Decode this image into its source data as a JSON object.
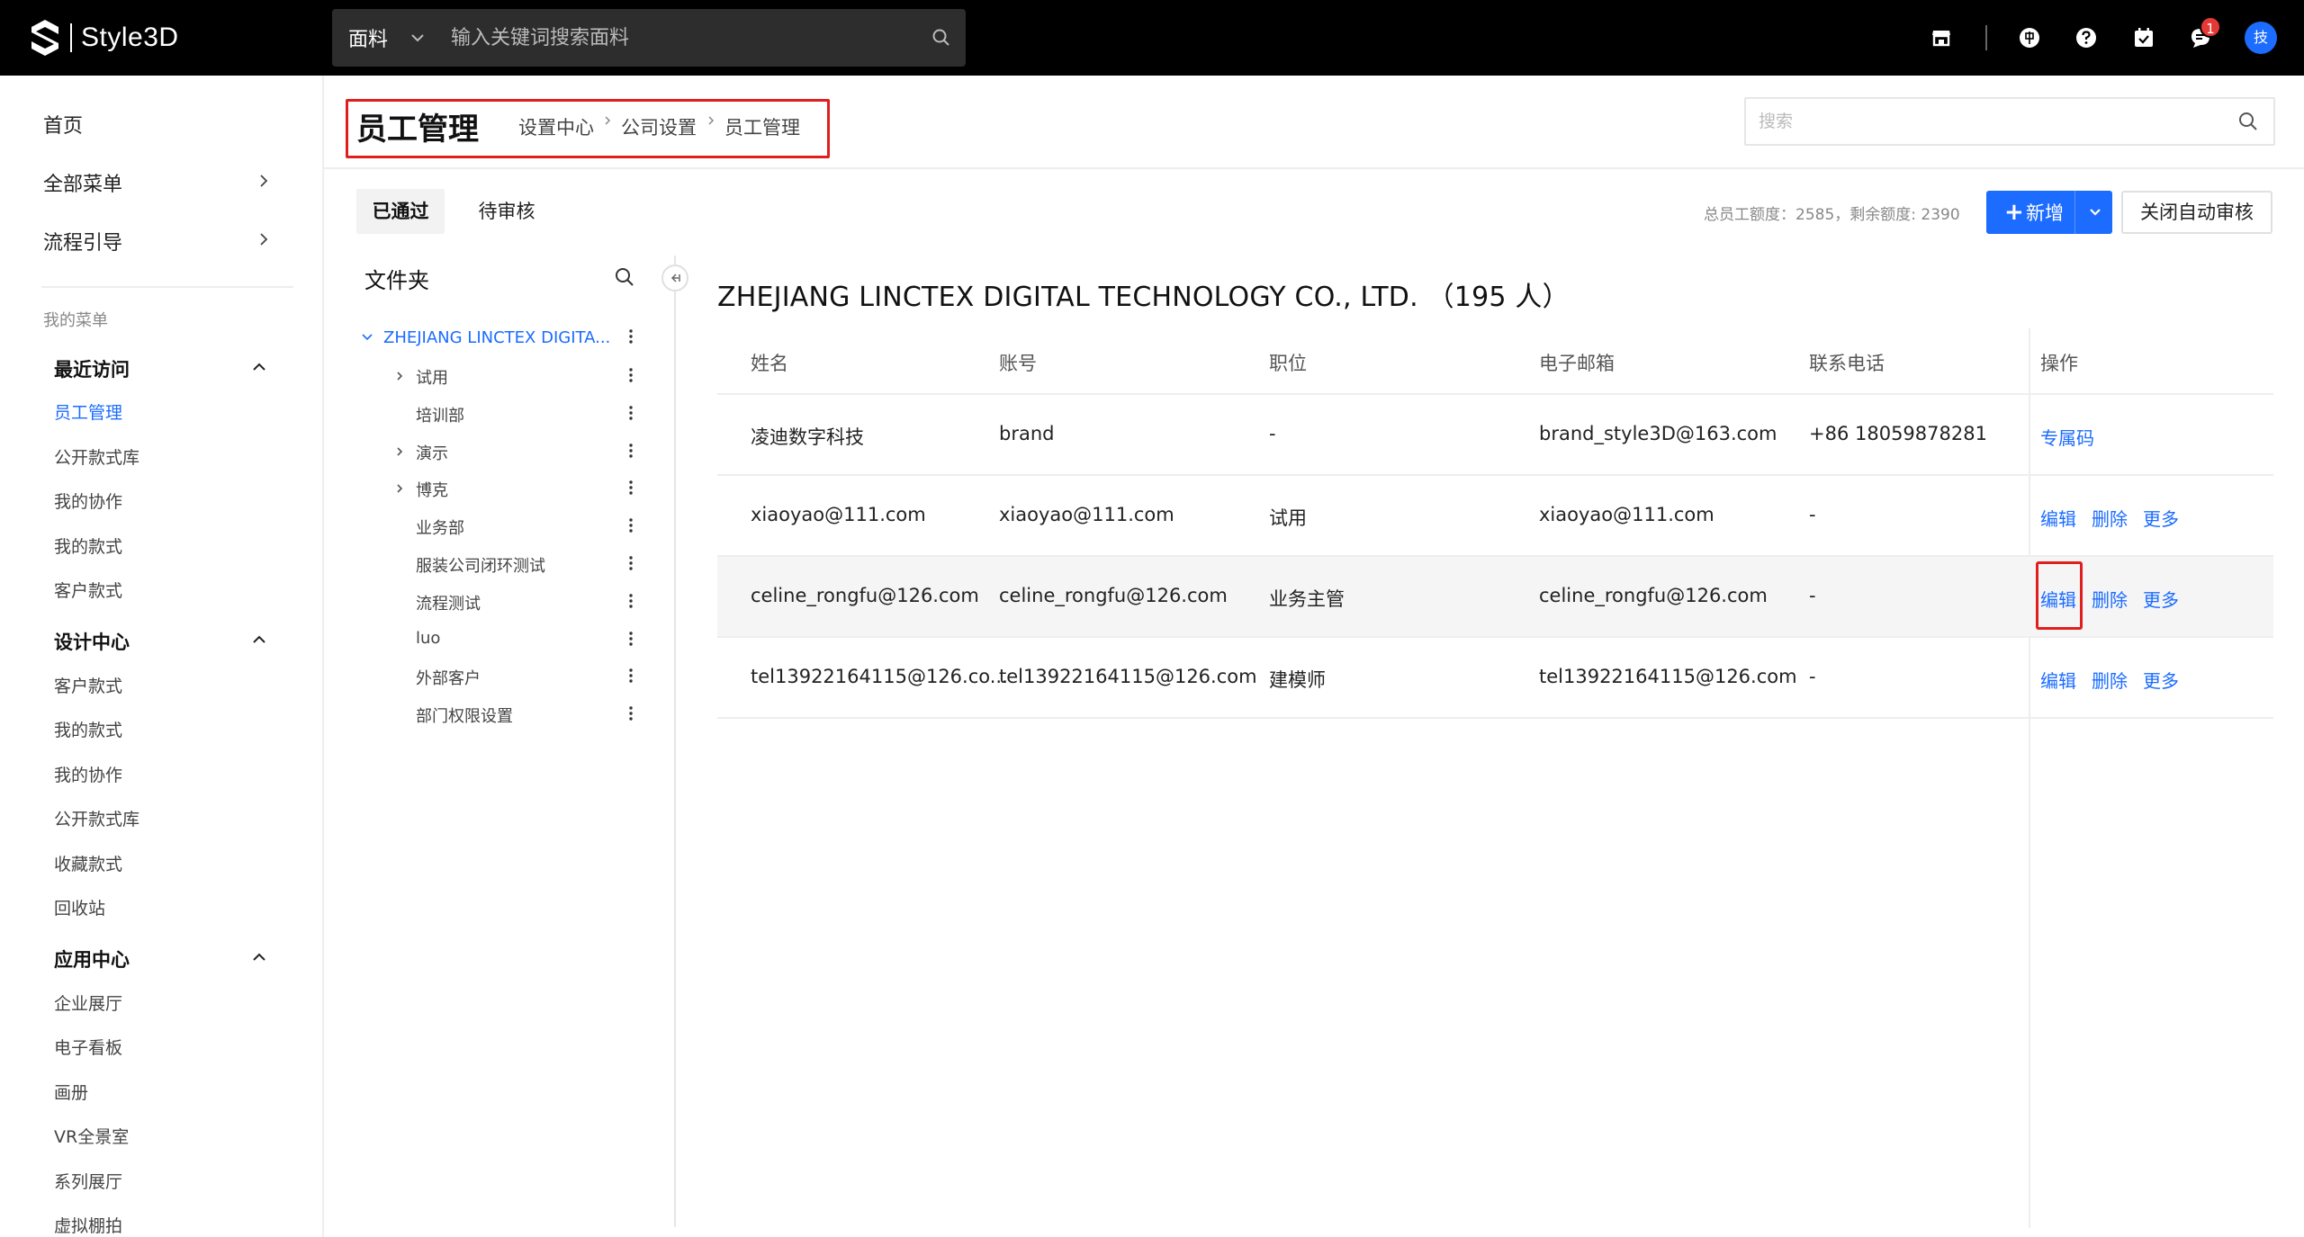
{
  "app": {
    "name": "Style3D",
    "search_category": "面料",
    "search_placeholder": "输入关键词搜索面料",
    "notification_count": "1",
    "avatar_text": "技"
  },
  "sidebar": {
    "home": "首页",
    "all_menu": "全部菜单",
    "flow_guide": "流程引导",
    "my_menu": "我的菜单",
    "recent": {
      "title": "最近访问",
      "items": [
        "员工管理",
        "公开款式库",
        "我的协作",
        "我的款式",
        "客户款式"
      ]
    },
    "design": {
      "title": "设计中心",
      "items": [
        "客户款式",
        "我的款式",
        "我的协作",
        "公开款式库",
        "收藏款式",
        "回收站"
      ]
    },
    "apps": {
      "title": "应用中心",
      "items": [
        "企业展厅",
        "电子看板",
        "画册",
        "VR全景室",
        "系列展厅",
        "虚拟棚拍"
      ]
    }
  },
  "header": {
    "title": "员工管理",
    "breadcrumb": [
      "设置中心",
      "公司设置",
      "员工管理"
    ],
    "search_placeholder": "搜索"
  },
  "tabs": [
    "已通过",
    "待审核"
  ],
  "quota_text": "总员工额度：2585，剩余额度: 2390",
  "buttons": {
    "add": "新增",
    "auto_review": "关闭自动审核"
  },
  "folder": {
    "title": "文件夹",
    "root": "ZHEJIANG LINCTEX DIGITA...",
    "children": [
      {
        "label": "试用",
        "expandable": true
      },
      {
        "label": "培训部",
        "expandable": false
      },
      {
        "label": "演示",
        "expandable": true
      },
      {
        "label": "博克",
        "expandable": true
      },
      {
        "label": "业务部",
        "expandable": false
      },
      {
        "label": "服装公司闭环测试",
        "expandable": false
      },
      {
        "label": "流程测试",
        "expandable": false
      },
      {
        "label": "luo",
        "expandable": false
      },
      {
        "label": "外部客户",
        "expandable": false
      },
      {
        "label": "部门权限设置",
        "expandable": false
      }
    ]
  },
  "table": {
    "company": "ZHEJIANG LINCTEX DIGITAL TECHNOLOGY CO., LTD. （195 人）",
    "headers": [
      "姓名",
      "账号",
      "职位",
      "电子邮箱",
      "联系电话",
      "操作"
    ],
    "rows": [
      {
        "name": "凌迪数字科技",
        "account": "brand",
        "position": "-",
        "email": "brand_style3D@163.com",
        "phone": "+86 18059878281",
        "actions": [
          "专属码"
        ]
      },
      {
        "name": "xiaoyao@111.com",
        "account": "xiaoyao@111.com",
        "position": "试用",
        "email": "xiaoyao@111.com",
        "phone": "-",
        "actions": [
          "编辑",
          "删除",
          "更多"
        ]
      },
      {
        "name": "celine_rongfu@126.com",
        "account": "celine_rongfu@126.com",
        "position": "业务主管",
        "email": "celine_rongfu@126.com",
        "phone": "-",
        "actions": [
          "编辑",
          "删除",
          "更多"
        ]
      },
      {
        "name": "tel13922164115@126.co...",
        "account": "tel13922164115@126.com",
        "position": "建模师",
        "email": "tel13922164115@126.com",
        "phone": "-",
        "actions": [
          "编辑",
          "删除",
          "更多"
        ]
      }
    ]
  },
  "colors": {
    "accent": "#1b6cff",
    "highlight": "#e01e1e",
    "topbar": "#000000"
  }
}
